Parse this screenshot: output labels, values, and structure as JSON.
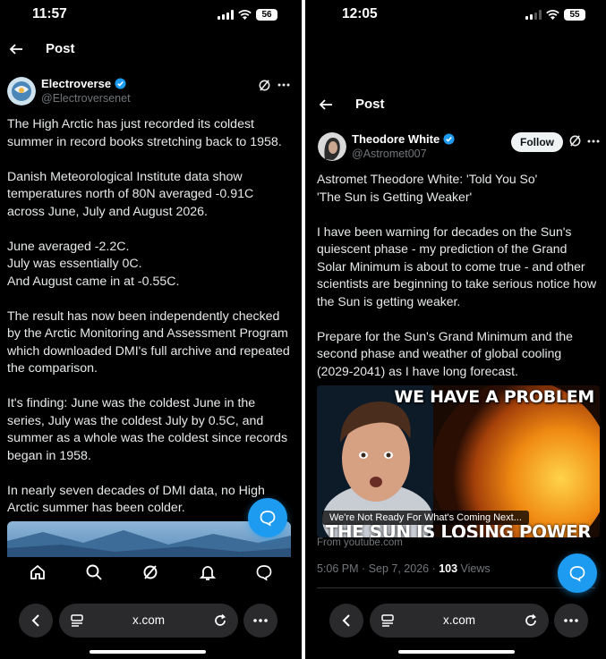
{
  "left": {
    "status": {
      "time": "11:57",
      "battery": "56"
    },
    "header": {
      "title": "Post"
    },
    "author": {
      "name": "Electroverse",
      "handle": "@Electroversenet"
    },
    "paragraphs": [
      [
        "The High Arctic has just recorded its coldest",
        "summer in record books stretching back to 1958."
      ],
      [
        "Danish Meteorological Institute data show",
        "temperatures north of 80N averaged -0.91C",
        "across June, July and August 2026."
      ],
      [
        "June averaged -2.2C.",
        "July was essentially 0C.",
        "And August came in at -0.55C."
      ],
      [
        "The result has now been independently checked",
        "by the Arctic Monitoring and Assessment Program",
        "which downloaded DMI's full archive and repeated",
        "the comparison."
      ],
      [
        "It's finding: June was the coldest June in the",
        "series, July was the coldest July by 0.5C, and",
        "summer as a whole was the coldest since records",
        "began in 1958."
      ],
      [
        "In nearly seven decades of DMI data, no High",
        "Arctic summer has been colder."
      ]
    ],
    "nav_icons": [
      "home-icon",
      "search-icon",
      "grok-icon",
      "notifications-icon",
      "messages-icon"
    ],
    "browser": {
      "url": "x.com"
    }
  },
  "right": {
    "status": {
      "time": "12:05",
      "battery": "55"
    },
    "header": {
      "title": "Post"
    },
    "author": {
      "name": "Theodore White",
      "handle": "@Astromet007"
    },
    "follow_label": "Follow",
    "paragraphs": [
      [
        "Astromet Theodore White: 'Told You So'",
        "'The Sun is Getting Weaker'"
      ],
      [
        "I have been warning for decades on the Sun's",
        "quiescent phase - my prediction of the Grand",
        "Solar Minimum is about to come true - and other",
        "scientists are beginning to take serious notice how",
        "the Sun is getting weaker."
      ],
      [
        "Prepare for the Sun's Grand Minimum and the",
        "second phase and weather of global cooling",
        "(2029-2041) as I have long forecast."
      ]
    ],
    "card": {
      "headline": "WE HAVE A PROBLEM",
      "caption": "We're Not Ready For What's Coming Next...",
      "bottom_text": "THE SUN IS LOSING POWER",
      "source": "From youtube.com"
    },
    "meta": {
      "time": "5:06 PM",
      "sep1": " · ",
      "date": "Sep 7, 2026",
      "sep2": " · ",
      "views_count": "103",
      "views_label": " Views"
    },
    "browser": {
      "url": "x.com"
    }
  },
  "colors": {
    "accent": "#1d9bf0",
    "background": "#000000",
    "text": "#e7e9ea",
    "muted": "#71767b"
  }
}
